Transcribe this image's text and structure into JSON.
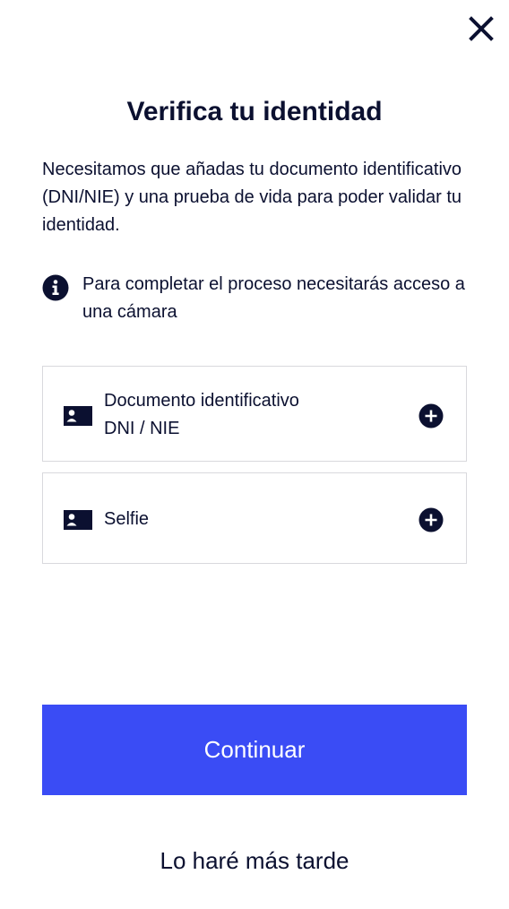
{
  "header": {
    "close_icon": "close-icon"
  },
  "title": "Verifica tu identidad",
  "intro": "Necesitamos que añadas tu documento identificativo (DNI/NIE) y una prueba de vida para poder validar tu identidad.",
  "info": {
    "icon": "info-icon",
    "text": "Para completar el proceso necesitarás acceso a una cámara"
  },
  "cards": {
    "document": {
      "icon": "id-card-icon",
      "line1": "Documento identificativo",
      "line2": "DNI / NIE",
      "action_icon": "plus-circle-icon"
    },
    "selfie": {
      "icon": "id-card-icon",
      "label": "Selfie",
      "action_icon": "plus-circle-icon"
    }
  },
  "actions": {
    "continue_label": "Continuar",
    "later_label": "Lo haré más tarde"
  },
  "colors": {
    "primary": "#3a4cf5",
    "text": "#0b1030",
    "border": "#d9d9dd"
  }
}
